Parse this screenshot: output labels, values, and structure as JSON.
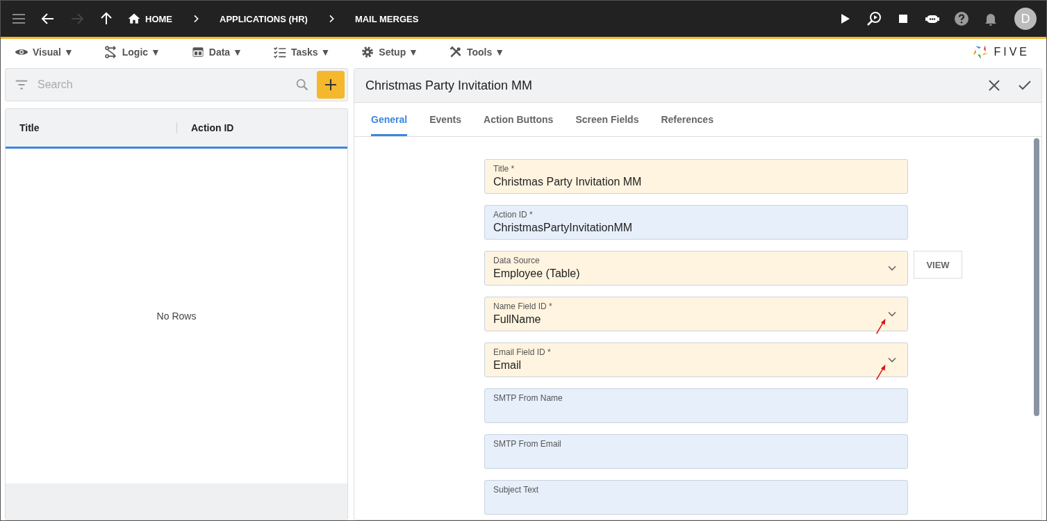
{
  "top_bar": {
    "breadcrumbs": [
      {
        "label": "HOME",
        "kind": "home"
      },
      {
        "label": "APPLICATIONS (HR)",
        "kind": "plain"
      },
      {
        "label": "MAIL MERGES",
        "kind": "plain"
      }
    ],
    "avatar": "D"
  },
  "menu": [
    {
      "label": "Visual ▼"
    },
    {
      "label": "Logic ▼"
    },
    {
      "label": "Data ▼"
    },
    {
      "label": "Tasks ▼"
    },
    {
      "label": "Setup ▼"
    },
    {
      "label": "Tools ▼"
    }
  ],
  "logo": "FIVE",
  "list_panel": {
    "search": {
      "placeholder": "Search"
    },
    "columns": [
      "Title",
      "Action ID"
    ],
    "empty_text": "No Rows"
  },
  "form": {
    "title": "Christmas Party Invitation MM",
    "tabs": [
      {
        "label": "General",
        "selected": true
      },
      {
        "label": "Events",
        "selected": false
      },
      {
        "label": "Action Buttons",
        "selected": false
      },
      {
        "label": "Screen Fields",
        "selected": false
      },
      {
        "label": "References",
        "selected": false
      }
    ],
    "fields": [
      {
        "label": "Title *",
        "value": "Christmas Party Invitation MM",
        "kind": "text",
        "color": "#fff4e0",
        "pointer_arrow": false
      },
      {
        "label": "Action ID *",
        "value": "ChristmasPartyInvitationMM",
        "kind": "text",
        "color": "#e6effa",
        "pointer_arrow": false
      },
      {
        "label": "Data Source",
        "value": "Employee (Table)",
        "kind": "select",
        "color": "#fff4e0",
        "pointer_arrow": false,
        "button": "VIEW"
      },
      {
        "label": "Name Field ID *",
        "value": "FullName",
        "kind": "select",
        "color": "#fff4e0",
        "pointer_arrow": true
      },
      {
        "label": "Email Field ID *",
        "value": "Email",
        "kind": "select",
        "color": "#fff4e0",
        "pointer_arrow": true
      },
      {
        "label": "SMTP From Name",
        "kind": "text",
        "color": "#e6effa",
        "pointer_arrow": false
      },
      {
        "label": "SMTP From Email",
        "kind": "text",
        "color": "#e6effa",
        "pointer_arrow": false
      },
      {
        "label": "Subject Text",
        "kind": "text",
        "color": "#e6effa",
        "pointer_arrow": false
      }
    ]
  }
}
